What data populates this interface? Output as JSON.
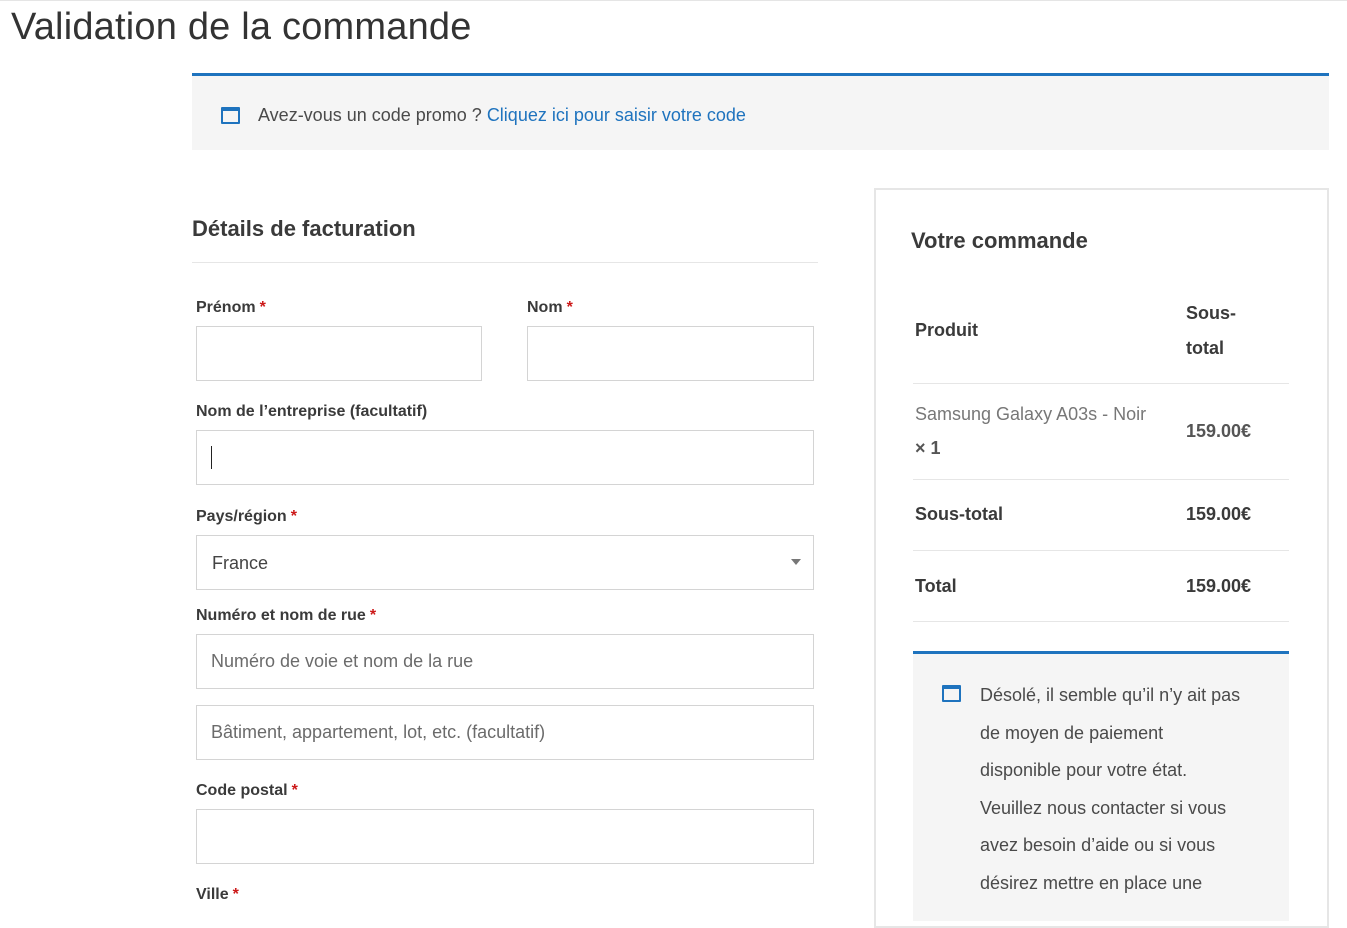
{
  "page": {
    "title": "Validation de la commande"
  },
  "promo": {
    "text": "Avez-vous un code promo ?",
    "link": "Cliquez ici pour saisir votre code"
  },
  "billing": {
    "title": "Détails de facturation",
    "required_mark": "*",
    "first_name_label": "Prénom",
    "last_name_label": "Nom",
    "company_label": "Nom de l’entreprise (facultatif)",
    "country_label": "Pays/région",
    "country_value": "France",
    "street_label": "Numéro et nom de rue",
    "street_placeholder": "Numéro de voie et nom de la rue",
    "street2_placeholder": "Bâtiment, appartement, lot, etc. (facultatif)",
    "postcode_label": "Code postal",
    "city_label": "Ville"
  },
  "order": {
    "title": "Votre commande",
    "col_product": "Produit",
    "col_subtotal": "Sous-total",
    "col_subtotal_line1": "Sous-",
    "col_subtotal_line2": "total",
    "item_name": "Samsung Galaxy A03s - Noir",
    "item_qty": "× 1",
    "item_price": "159.00€",
    "subtotal_label": "Sous-total",
    "subtotal_value": "159.00€",
    "total_label": "Total",
    "total_value": "159.00€"
  },
  "payment_notice": {
    "lines": [
      "Désolé, il semble qu’il n’y ait pas",
      "de moyen de paiement",
      "disponible pour votre état.",
      "Veuillez nous contacter si vous",
      "avez besoin d’aide ou si vous",
      "désirez mettre en place une"
    ]
  },
  "colors": {
    "accent": "#1e73be",
    "required": "#cc1818",
    "panel": "#f5f5f5"
  },
  "icons": {
    "promo": "window-icon",
    "notice": "window-icon"
  }
}
